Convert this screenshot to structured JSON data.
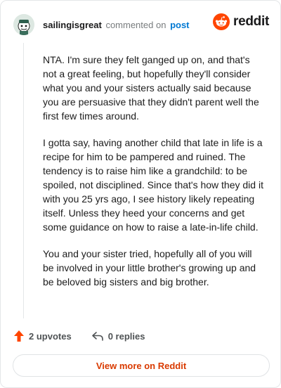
{
  "header": {
    "username": "sailingisgreat",
    "action_text": "commented on",
    "post_link": "post",
    "brand": "reddit"
  },
  "comment": {
    "paragraphs": [
      "NTA. I'm sure they felt ganged up on, and that's not a great feeling, but hopefully they'll consider what you and your sisters actually said because you are persuasive that they didn't parent well the first few times around.",
      "I gotta say, having another child that late in life is a recipe for him to be pampered and ruined. The tendency is to raise him like a grandchild: to be spoiled, not disciplined. Since that's how they did it with you 25 yrs ago, I see history likely repeating itself. Unless they heed your concerns and get some guidance on how to raise a late-in-life child.",
      "You and your sister tried, hopefully all of you will be involved in your little brother's growing up and be beloved big sisters and big brother."
    ]
  },
  "actions": {
    "upvotes": "2 upvotes",
    "replies": "0 replies"
  },
  "footer": {
    "view_more": "View more on Reddit"
  },
  "colors": {
    "brand_orange": "#ff4500",
    "link_blue": "#0079d3",
    "cta_red": "#d93a00"
  },
  "icons": [
    "avatar",
    "reddit-logo-icon",
    "upvote-arrow-icon",
    "reply-arrow-icon"
  ]
}
